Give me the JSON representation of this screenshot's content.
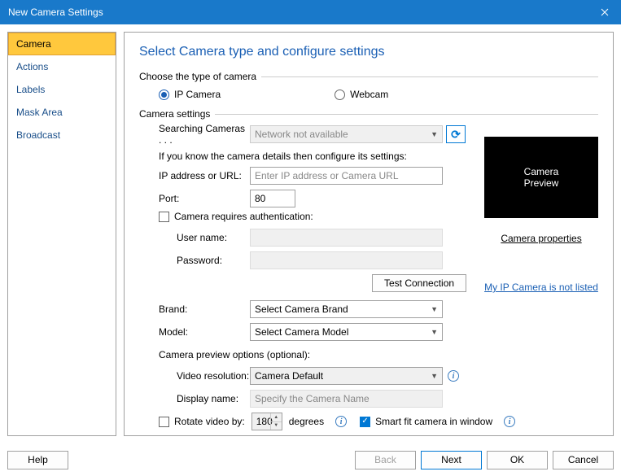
{
  "window": {
    "title": "New Camera Settings"
  },
  "sidebar": {
    "items": [
      {
        "label": "Camera",
        "active": true
      },
      {
        "label": "Actions",
        "active": false
      },
      {
        "label": "Labels",
        "active": false
      },
      {
        "label": "Mask Area",
        "active": false
      },
      {
        "label": "Broadcast",
        "active": false
      }
    ]
  },
  "main": {
    "title": "Select Camera type and configure settings",
    "type_group": "Choose the type of camera",
    "radios": {
      "ip": "IP Camera",
      "webcam": "Webcam"
    },
    "settings_group": "Camera settings",
    "search_label": "Searching Cameras . . .",
    "search_value": "Network not available",
    "know_hint": "If you know the camera details then configure its settings:",
    "ip_label": "IP address or URL:",
    "ip_placeholder": "Enter IP address or Camera URL",
    "port_label": "Port:",
    "port_value": "80",
    "auth_label": "Camera requires authentication:",
    "user_label": "User name:",
    "pass_label": "Password:",
    "test_btn": "Test Connection",
    "brand_label": "Brand:",
    "brand_value": "Select Camera Brand",
    "model_label": "Model:",
    "model_value": "Select Camera Model",
    "preview_opts": "Camera preview options (optional):",
    "res_label": "Video resolution:",
    "res_value": "Camera Default",
    "name_label": "Display name:",
    "name_placeholder": "Specify the Camera Name",
    "rotate_label": "Rotate video by:",
    "rotate_value": "180",
    "degrees": "degrees",
    "smartfit": "Smart fit camera in window"
  },
  "preview": {
    "box": "Camera\nPreview",
    "props_link": "Camera properties",
    "notlisted_link": "My IP Camera is not listed"
  },
  "footer": {
    "help": "Help",
    "back": "Back",
    "next": "Next",
    "ok": "OK",
    "cancel": "Cancel"
  }
}
